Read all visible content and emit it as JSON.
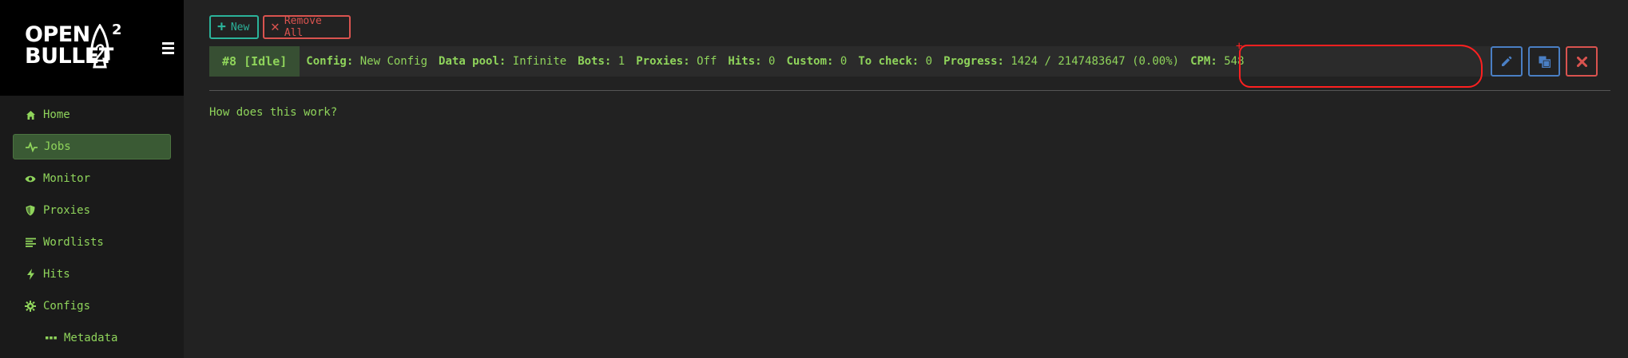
{
  "brand": {
    "line1": "OPEN",
    "line2": "BULLET",
    "sup": "2"
  },
  "sidebar": {
    "items": [
      {
        "label": "Home",
        "icon": "home-icon"
      },
      {
        "label": "Jobs",
        "icon": "pulse-icon",
        "active": true
      },
      {
        "label": "Monitor",
        "icon": "eye-icon"
      },
      {
        "label": "Proxies",
        "icon": "shield-icon"
      },
      {
        "label": "Wordlists",
        "icon": "list-icon"
      },
      {
        "label": "Hits",
        "icon": "bolt-icon"
      },
      {
        "label": "Configs",
        "icon": "gear-icon"
      },
      {
        "label": "Metadata",
        "icon": "dots-icon"
      }
    ]
  },
  "toolbar": {
    "new_label": "New",
    "remove_all_label": "Remove All"
  },
  "job": {
    "id": "#8 [Idle]",
    "config_key": "Config:",
    "config_val": "New Config",
    "datapool_key": "Data pool:",
    "datapool_val": "Infinite",
    "bots_key": "Bots:",
    "bots_val": "1",
    "proxies_key": "Proxies:",
    "proxies_val": "Off",
    "hits_key": "Hits:",
    "hits_val": "0",
    "custom_key": "Custom:",
    "custom_val": "0",
    "tocheck_key": "To check:",
    "tocheck_val": "0",
    "progress_key": "Progress:",
    "progress_val": "1424 / 2147483647 (0.00%)",
    "cpm_key": "CPM:",
    "cpm_val": "548"
  },
  "help_link": "How does this work?",
  "colors": {
    "accent_green": "#8fd45b",
    "teal": "#2bb39a",
    "danger": "#d9534f",
    "edit_blue": "#4a7fc4",
    "annotation_red": "#ff2020"
  }
}
